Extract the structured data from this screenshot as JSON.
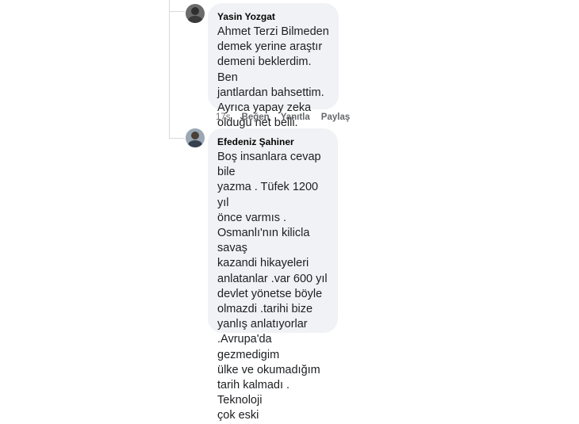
{
  "comments": [
    {
      "author": "Yasin Yozgat",
      "text": "Ahmet Terzi Bilmeden\ndemek yerine araştır\ndemeni beklerdim. Ben\njantlardan bahsettim.\nAyrıca yapay zeka\nolduğu net belli.",
      "time": "17s",
      "like_label": "Beğen",
      "reply_label": "Yanıtla",
      "share_label": "Paylaş"
    },
    {
      "author": "Efedeniz Şahiner",
      "text": "Boş insanlara cevap bile\nyazma . Tüfek 1200 yıl\nönce varmıs .\nOsmanlı'nın kilicla savaş\nkazandi hikayeleri\nanlatanlar .var 600 yıl\ndevlet yönetse böyle\nolmazdi .tarihi bize\nyanlış anlatıyorlar\n.Avrupa'da gezmedigim\nülke ve okumadığım\ntarih kalmadı . Teknoloji\nçok eski"
    }
  ],
  "colors": {
    "bubble": "#f0f2f5",
    "meta": "#65676b",
    "thread": "#d8dadf"
  },
  "icons": [
    "avatar-yasin",
    "avatar-efedeniz"
  ]
}
